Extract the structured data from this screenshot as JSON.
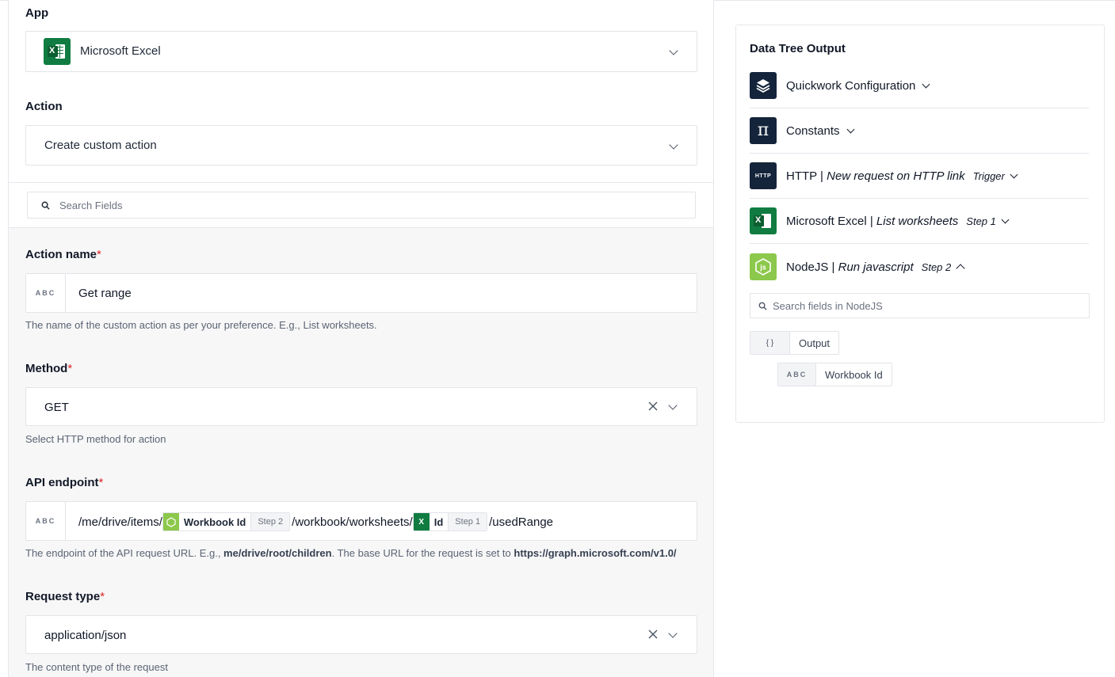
{
  "left": {
    "app": {
      "label": "App",
      "value": "Microsoft Excel"
    },
    "action": {
      "label": "Action",
      "value": "Create custom action"
    },
    "search": {
      "placeholder": "Search Fields"
    },
    "action_name": {
      "label": "Action name",
      "required": "*",
      "type_badge": "ABC",
      "value": "Get range",
      "helper": "The name of the custom action as per your preference. E.g., List worksheets."
    },
    "method": {
      "label": "Method",
      "required": "*",
      "value": "GET",
      "helper": "Select HTTP method for action"
    },
    "api_endpoint": {
      "label": "API endpoint",
      "required": "*",
      "type_badge": "ABC",
      "seg1": "/me/drive/items/",
      "pill1_name": "Workbook Id",
      "pill1_step": "Step 2",
      "seg2": "/workbook/worksheets/",
      "pill2_name": "Id",
      "pill2_step": "Step 1",
      "seg3": "/usedRange",
      "helper_a": "The endpoint of the API request URL. E.g., ",
      "helper_b": "me/drive/root/children",
      "helper_c": ". The base URL for the request is set to ",
      "helper_d": "https://graph.microsoft.com/v1.0/"
    },
    "request_type": {
      "label": "Request type",
      "required": "*",
      "value": "application/json",
      "helper": "The content type of the request"
    }
  },
  "right": {
    "title": "Data Tree Output",
    "items": [
      {
        "icon": "layers-icon",
        "text": "Quickwork Configuration"
      },
      {
        "icon": "pi-icon",
        "text": "Constants"
      },
      {
        "icon": "http-icon",
        "icon_text": "HTTP",
        "app": "HTTP | ",
        "trigger": "New request on HTTP link",
        "badge": "Trigger"
      },
      {
        "icon": "excel-icon",
        "app": "Microsoft Excel | ",
        "trigger": "List worksheets",
        "badge": "Step 1"
      },
      {
        "icon": "nodejs-icon",
        "app": "NodeJS | ",
        "trigger": "Run javascript",
        "badge": "Step 2"
      }
    ],
    "search_placeholder": "Search fields in NodeJS",
    "output_icon": "{ }",
    "output_label": "Output",
    "child_badge": "ABC",
    "child_label": "Workbook Id"
  },
  "colors": {
    "excel_green": "#107c41",
    "node_green": "#8cc84b",
    "navy": "#14243a",
    "required_red": "#dc2626"
  }
}
